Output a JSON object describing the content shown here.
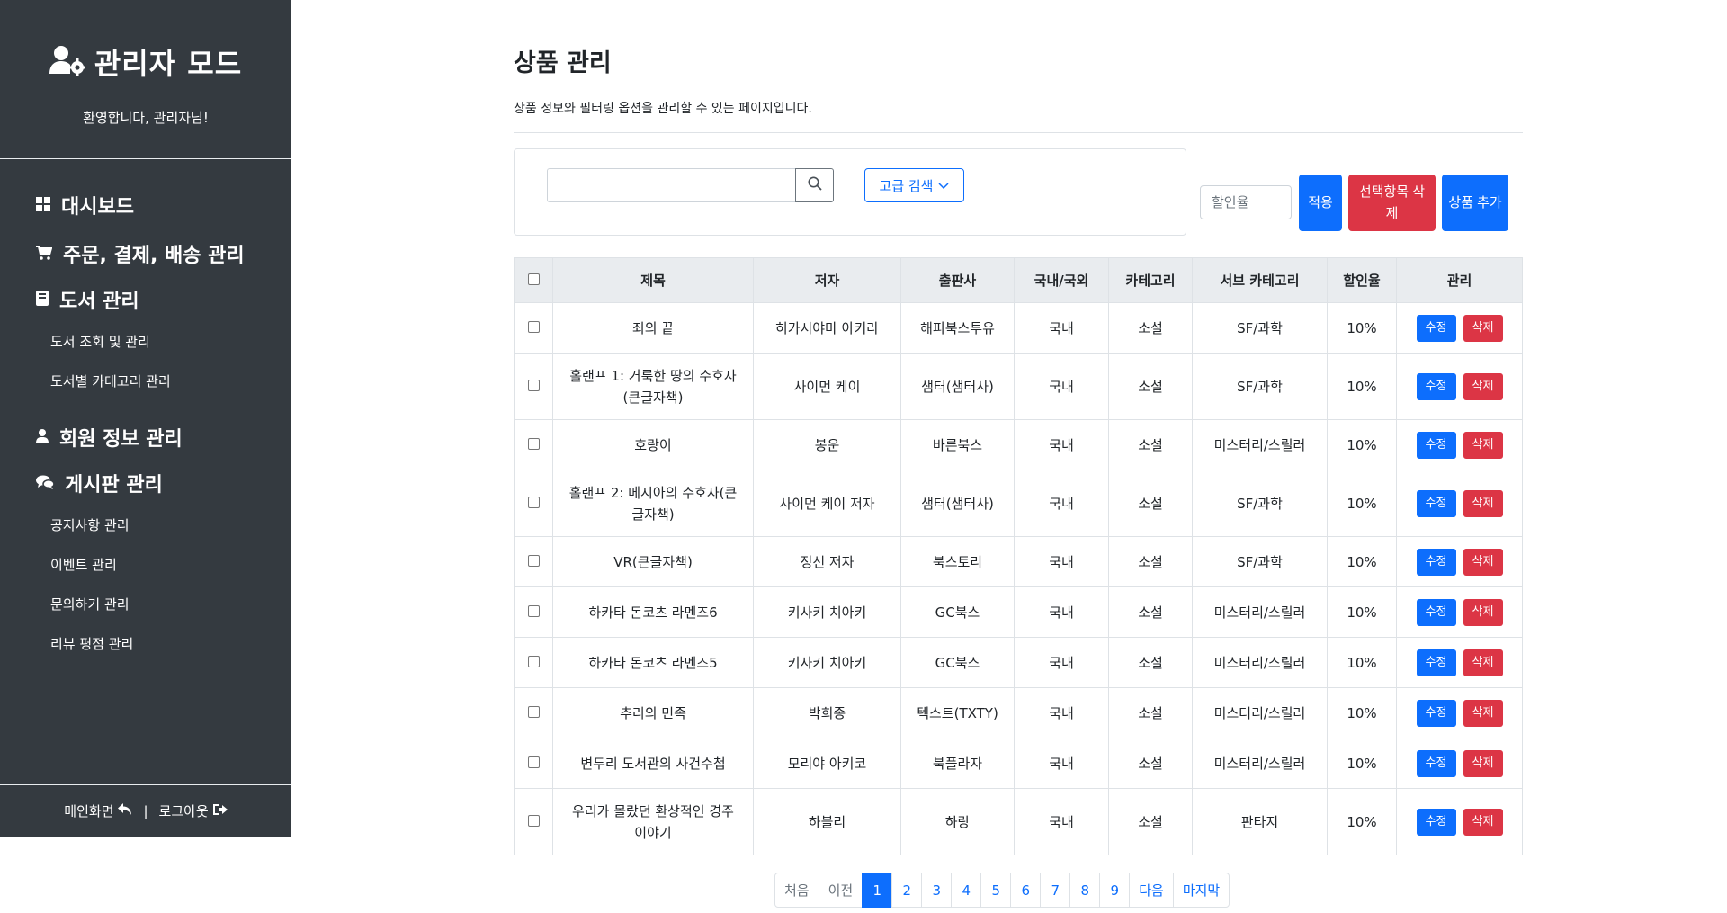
{
  "sidebar": {
    "title": "관리자 모드",
    "welcome": "환영합니다, 관리자님!",
    "nav": {
      "dashboard": "대시보드",
      "orders": "주문, 결제, 배송 관리",
      "books": "도서 관리",
      "books_sub": [
        "도서 조회 및 관리",
        "도서별 카테고리 관리"
      ],
      "members": "회원 정보 관리",
      "boards": "게시판 관리",
      "boards_sub": [
        "공지사항 관리",
        "이벤트 관리",
        "문의하기 관리",
        "리뷰 평점 관리"
      ]
    },
    "footer": {
      "main": "메인화면",
      "separator": "|",
      "logout": "로그아웃"
    }
  },
  "main": {
    "title": "상품 관리",
    "description": "상품 정보와 필터링 옵션을 관리할 수 있는 페이지입니다.",
    "search": {
      "value": "",
      "advanced_label": "고급 검색"
    },
    "discount_placeholder": "할인율",
    "buttons": {
      "apply": "적용",
      "delete_selected": "선택항목 삭제",
      "add_product": "상품 추가"
    }
  },
  "table": {
    "headers": [
      "제목",
      "저자",
      "출판사",
      "국내/국외",
      "카테고리",
      "서브 카테고리",
      "할인율",
      "관리"
    ],
    "edit_label": "수정",
    "delete_label": "삭제",
    "rows": [
      {
        "title": "죄의 끝",
        "author": "히가시야마 아키라",
        "publisher": "해피북스투유",
        "region": "국내",
        "category": "소설",
        "subcategory": "SF/과학",
        "discount": "10%"
      },
      {
        "title": "홀랜프 1: 거룩한 땅의 수호자(큰글자책)",
        "author": "사이먼 케이",
        "publisher": "샘터(샘터사)",
        "region": "국내",
        "category": "소설",
        "subcategory": "SF/과학",
        "discount": "10%"
      },
      {
        "title": "호랑이",
        "author": "봉운",
        "publisher": "바른북스",
        "region": "국내",
        "category": "소설",
        "subcategory": "미스터리/스릴러",
        "discount": "10%"
      },
      {
        "title": "홀랜프 2: 메시아의 수호자(큰글자책)",
        "author": "사이먼 케이 저자",
        "publisher": "샘터(샘터사)",
        "region": "국내",
        "category": "소설",
        "subcategory": "SF/과학",
        "discount": "10%"
      },
      {
        "title": "VR(큰글자책)",
        "author": "정선 저자",
        "publisher": "북스토리",
        "region": "국내",
        "category": "소설",
        "subcategory": "SF/과학",
        "discount": "10%"
      },
      {
        "title": "하카타 돈코츠 라멘즈6",
        "author": "키사키 치아키",
        "publisher": "GC북스",
        "region": "국내",
        "category": "소설",
        "subcategory": "미스터리/스릴러",
        "discount": "10%"
      },
      {
        "title": "하카타 돈코츠 라멘즈5",
        "author": "키사키 치아키",
        "publisher": "GC북스",
        "region": "국내",
        "category": "소설",
        "subcategory": "미스터리/스릴러",
        "discount": "10%"
      },
      {
        "title": "추리의 민족",
        "author": "박희종",
        "publisher": "텍스트(TXTY)",
        "region": "국내",
        "category": "소설",
        "subcategory": "미스터리/스릴러",
        "discount": "10%"
      },
      {
        "title": "변두리 도서관의 사건수첩",
        "author": "모리야 아키코",
        "publisher": "북플라자",
        "region": "국내",
        "category": "소설",
        "subcategory": "미스터리/스릴러",
        "discount": "10%"
      },
      {
        "title": "우리가 몰랐던 환상적인 경주 이야기",
        "author": "하블리",
        "publisher": "하랑",
        "region": "국내",
        "category": "소설",
        "subcategory": "판타지",
        "discount": "10%"
      }
    ]
  },
  "pagination": {
    "first": "처음",
    "prev": "이전",
    "pages": [
      "1",
      "2",
      "3",
      "4",
      "5",
      "6",
      "7",
      "8",
      "9"
    ],
    "current": "1",
    "next": "다음",
    "last": "마지막"
  },
  "colors": {
    "sidebar_bg": "#343a40",
    "primary": "#0d6efd",
    "danger": "#dc3545",
    "table_header_bg": "#e9ecef"
  }
}
